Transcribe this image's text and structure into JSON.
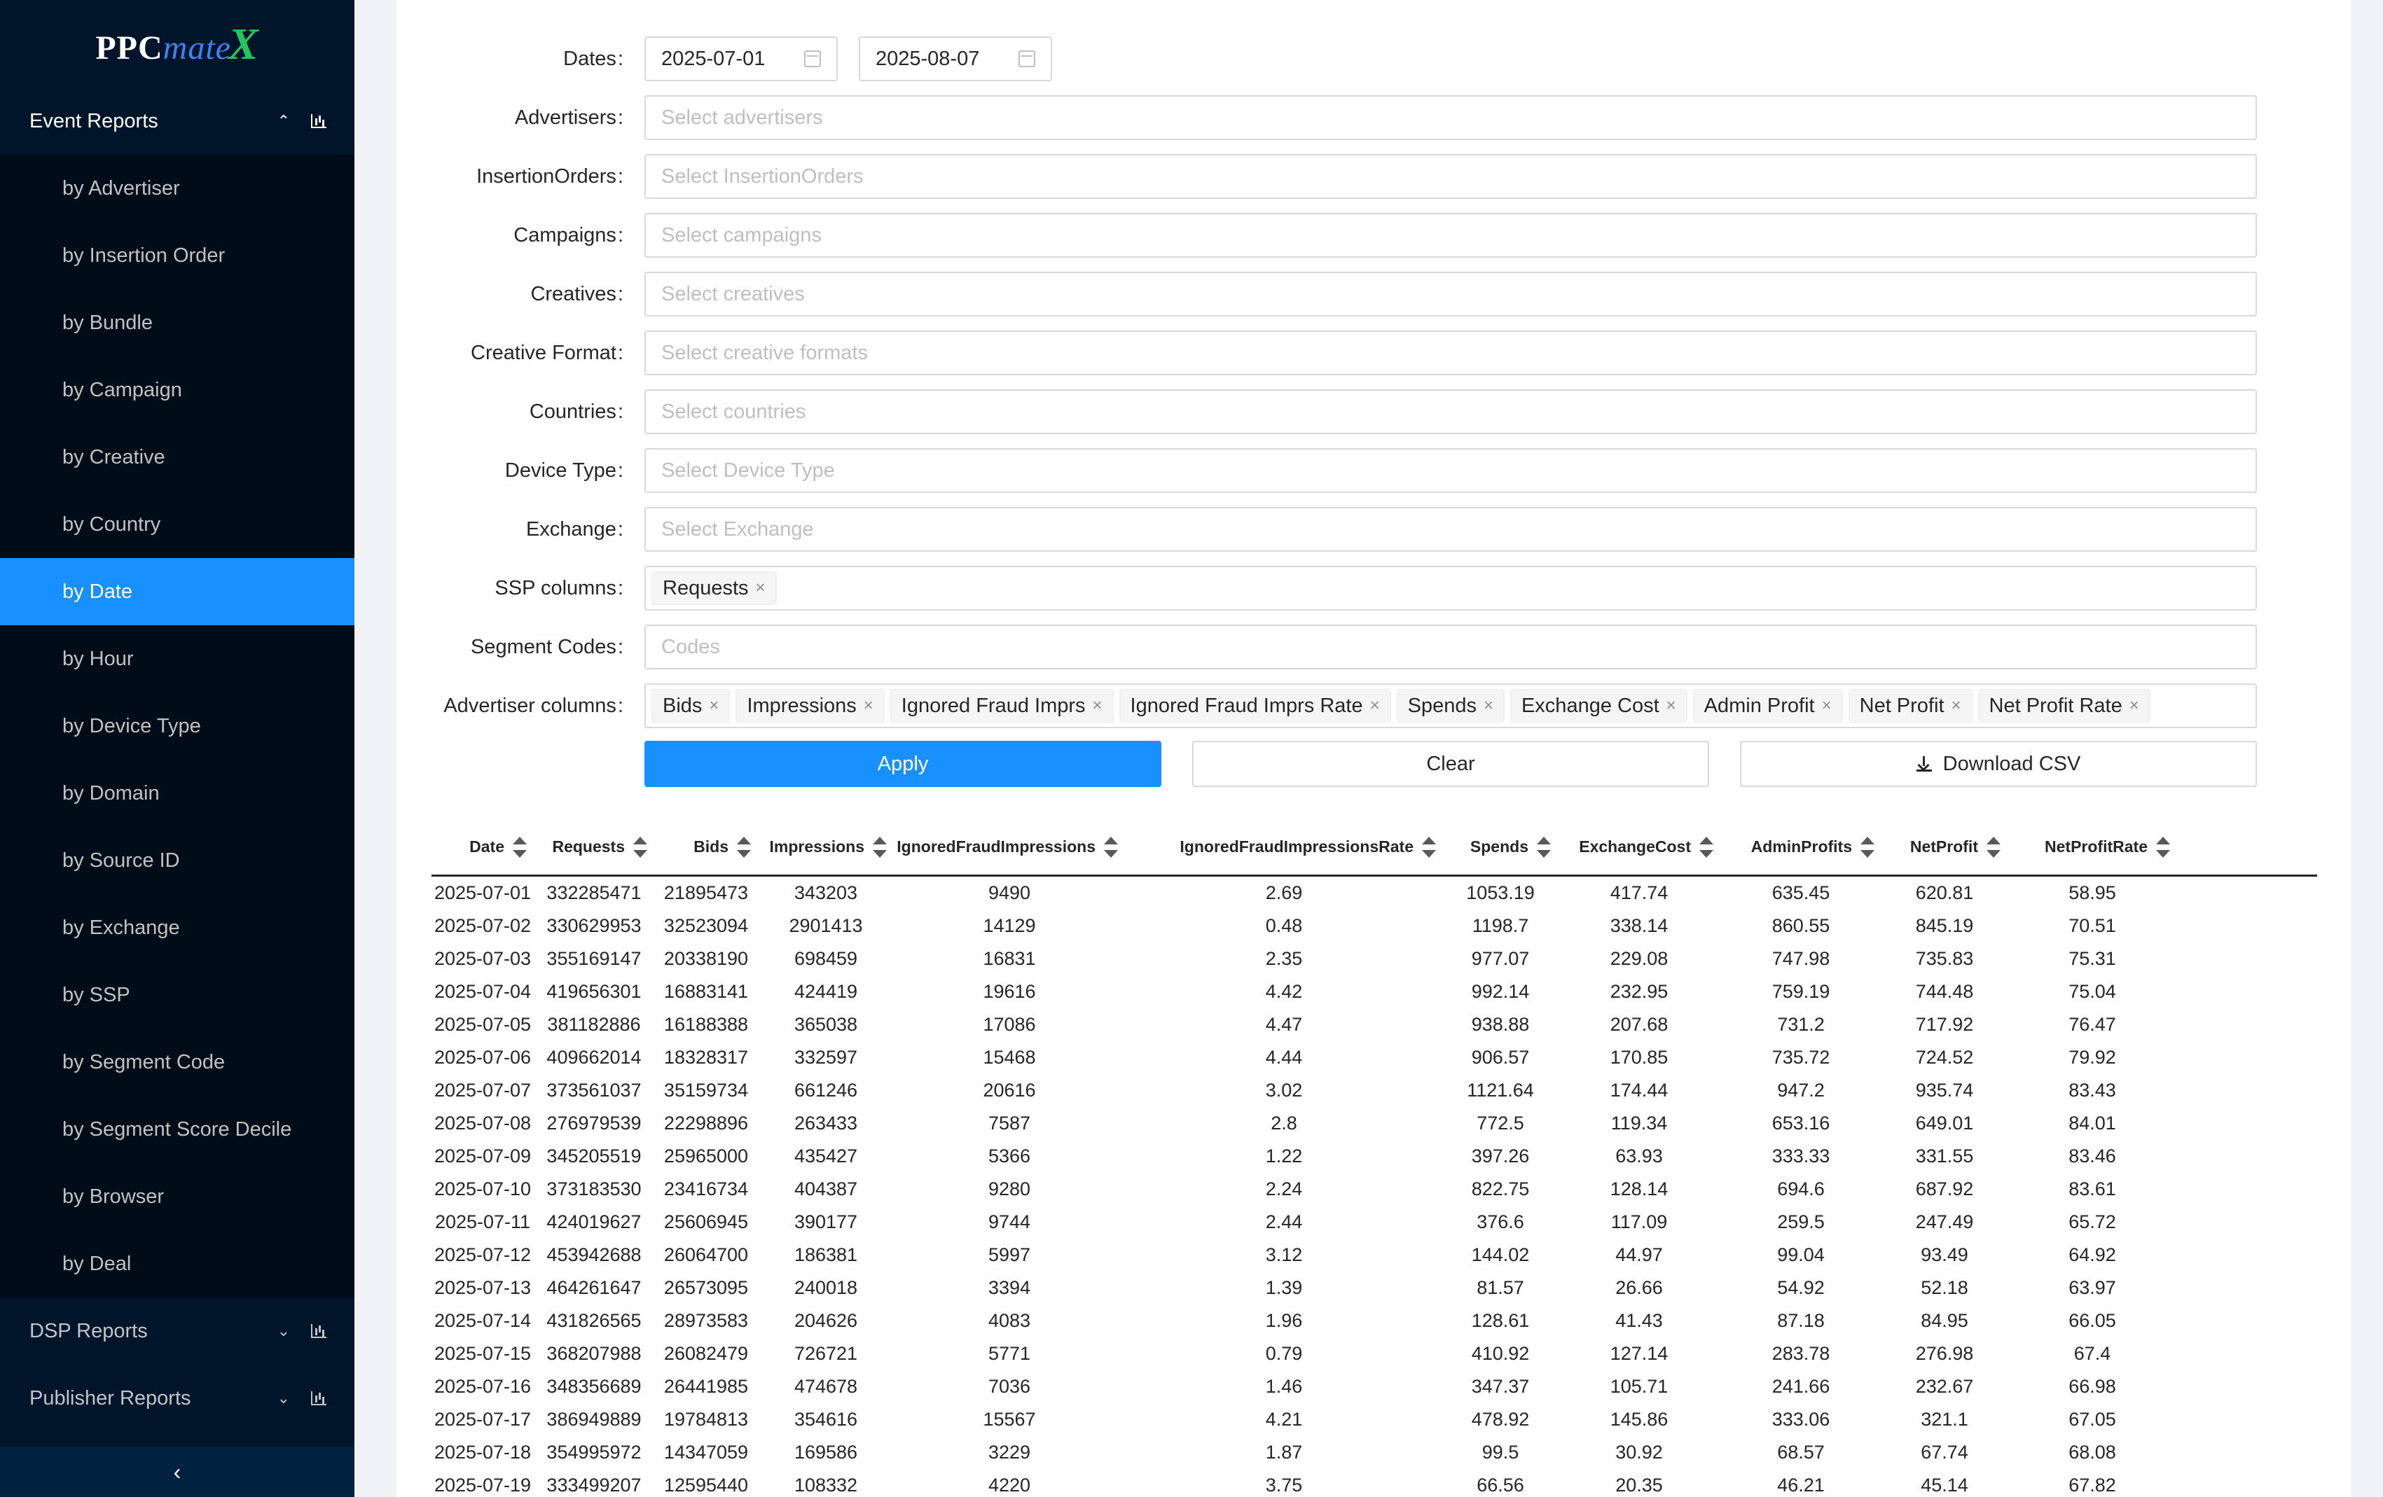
{
  "logo": {
    "ppc": "PPC",
    "mate": "mate",
    "x": "X"
  },
  "sidebar": {
    "event_reports": "Event Reports",
    "items": [
      {
        "label": "by Advertiser"
      },
      {
        "label": "by Insertion Order"
      },
      {
        "label": "by Bundle"
      },
      {
        "label": "by Campaign"
      },
      {
        "label": "by Creative"
      },
      {
        "label": "by Country"
      },
      {
        "label": "by Date",
        "active": true
      },
      {
        "label": "by Hour"
      },
      {
        "label": "by Device Type"
      },
      {
        "label": "by Domain"
      },
      {
        "label": "by Source ID"
      },
      {
        "label": "by Exchange"
      },
      {
        "label": "by SSP"
      },
      {
        "label": "by Segment Code"
      },
      {
        "label": "by Segment Score Decile"
      },
      {
        "label": "by Browser"
      },
      {
        "label": "by Deal"
      }
    ],
    "dsp_reports": "DSP Reports",
    "publisher_reports": "Publisher Reports",
    "collapse_icon": "chevron-left-icon"
  },
  "filters": {
    "dates_label": "Dates",
    "date_start": "2025-07-01",
    "date_end": "2025-08-07",
    "advertisers_label": "Advertisers",
    "advertisers_placeholder": "Select advertisers",
    "insertion_orders_label": "InsertionOrders",
    "insertion_orders_placeholder": "Select InsertionOrders",
    "campaigns_label": "Campaigns",
    "campaigns_placeholder": "Select campaigns",
    "creatives_label": "Creatives",
    "creatives_placeholder": "Select creatives",
    "creative_format_label": "Creative Format",
    "creative_format_placeholder": "Select creative formats",
    "countries_label": "Countries",
    "countries_placeholder": "Select countries",
    "device_type_label": "Device Type",
    "device_type_placeholder": "Select Device Type",
    "exchange_label": "Exchange",
    "exchange_placeholder": "Select Exchange",
    "ssp_columns_label": "SSP columns",
    "ssp_columns": [
      "Requests"
    ],
    "segment_codes_label": "Segment Codes",
    "segment_codes_placeholder": "Codes",
    "advertiser_columns_label": "Advertiser columns",
    "advertiser_columns": [
      "Bids",
      "Impressions",
      "Ignored Fraud Imprs",
      "Ignored Fraud Imprs Rate",
      "Spends",
      "Exchange Cost",
      "Admin Profit",
      "Net Profit",
      "Net Profit Rate"
    ]
  },
  "buttons": {
    "apply": "Apply",
    "clear": "Clear",
    "download": "Download CSV"
  },
  "table": {
    "columns": [
      "Date",
      "Requests",
      "Bids",
      "Impressions",
      "IgnoredFraudImpressions",
      "IgnoredFraudImpressionsRate",
      "Spends",
      "ExchangeCost",
      "AdminProfits",
      "NetProfit",
      "NetProfitRate"
    ],
    "rows": [
      [
        "2025-07-01",
        "332285471",
        "21895473",
        "343203",
        "9490",
        "2.69",
        "1053.19",
        "417.74",
        "635.45",
        "620.81",
        "58.95"
      ],
      [
        "2025-07-02",
        "330629953",
        "32523094",
        "2901413",
        "14129",
        "0.48",
        "1198.7",
        "338.14",
        "860.55",
        "845.19",
        "70.51"
      ],
      [
        "2025-07-03",
        "355169147",
        "20338190",
        "698459",
        "16831",
        "2.35",
        "977.07",
        "229.08",
        "747.98",
        "735.83",
        "75.31"
      ],
      [
        "2025-07-04",
        "419656301",
        "16883141",
        "424419",
        "19616",
        "4.42",
        "992.14",
        "232.95",
        "759.19",
        "744.48",
        "75.04"
      ],
      [
        "2025-07-05",
        "381182886",
        "16188388",
        "365038",
        "17086",
        "4.47",
        "938.88",
        "207.68",
        "731.2",
        "717.92",
        "76.47"
      ],
      [
        "2025-07-06",
        "409662014",
        "18328317",
        "332597",
        "15468",
        "4.44",
        "906.57",
        "170.85",
        "735.72",
        "724.52",
        "79.92"
      ],
      [
        "2025-07-07",
        "373561037",
        "35159734",
        "661246",
        "20616",
        "3.02",
        "1121.64",
        "174.44",
        "947.2",
        "935.74",
        "83.43"
      ],
      [
        "2025-07-08",
        "276979539",
        "22298896",
        "263433",
        "7587",
        "2.8",
        "772.5",
        "119.34",
        "653.16",
        "649.01",
        "84.01"
      ],
      [
        "2025-07-09",
        "345205519",
        "25965000",
        "435427",
        "5366",
        "1.22",
        "397.26",
        "63.93",
        "333.33",
        "331.55",
        "83.46"
      ],
      [
        "2025-07-10",
        "373183530",
        "23416734",
        "404387",
        "9280",
        "2.24",
        "822.75",
        "128.14",
        "694.6",
        "687.92",
        "83.61"
      ],
      [
        "2025-07-11",
        "424019627",
        "25606945",
        "390177",
        "9744",
        "2.44",
        "376.6",
        "117.09",
        "259.5",
        "247.49",
        "65.72"
      ],
      [
        "2025-07-12",
        "453942688",
        "26064700",
        "186381",
        "5997",
        "3.12",
        "144.02",
        "44.97",
        "99.04",
        "93.49",
        "64.92"
      ],
      [
        "2025-07-13",
        "464261647",
        "26573095",
        "240018",
        "3394",
        "1.39",
        "81.57",
        "26.66",
        "54.92",
        "52.18",
        "63.97"
      ],
      [
        "2025-07-14",
        "431826565",
        "28973583",
        "204626",
        "4083",
        "1.96",
        "128.61",
        "41.43",
        "87.18",
        "84.95",
        "66.05"
      ],
      [
        "2025-07-15",
        "368207988",
        "26082479",
        "726721",
        "5771",
        "0.79",
        "410.92",
        "127.14",
        "283.78",
        "276.98",
        "67.4"
      ],
      [
        "2025-07-16",
        "348356689",
        "26441985",
        "474678",
        "7036",
        "1.46",
        "347.37",
        "105.71",
        "241.66",
        "232.67",
        "66.98"
      ],
      [
        "2025-07-17",
        "386949889",
        "19784813",
        "354616",
        "15567",
        "4.21",
        "478.92",
        "145.86",
        "333.06",
        "321.1",
        "67.05"
      ],
      [
        "2025-07-18",
        "354995972",
        "14347059",
        "169586",
        "3229",
        "1.87",
        "99.5",
        "30.92",
        "68.57",
        "67.74",
        "68.08"
      ],
      [
        "2025-07-19",
        "333499207",
        "12595440",
        "108332",
        "4220",
        "3.75",
        "66.56",
        "20.35",
        "46.21",
        "45.14",
        "67.82"
      ]
    ]
  }
}
